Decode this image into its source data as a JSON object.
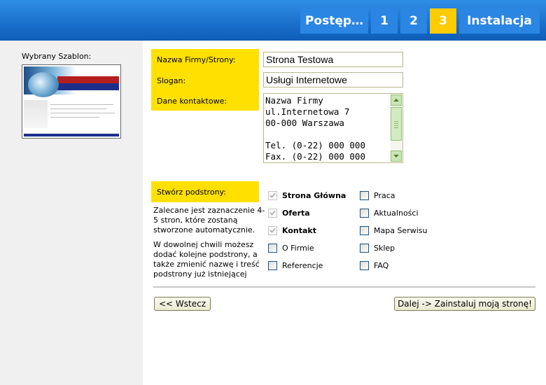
{
  "progress": {
    "label": "Postęp…",
    "steps": [
      "1",
      "2",
      "3"
    ],
    "active_step": "3",
    "final": "Instalacja"
  },
  "template": {
    "label": "Wybrany Szablon:",
    "thumbnail_icon": "template-thumbnail"
  },
  "form": {
    "company_label": "Nazwa Firmy/Strony:",
    "company_value": "Strona Testowa",
    "slogan_label": "Slogan:",
    "slogan_value": "Usługi Internetowe",
    "contact_label": "Dane kontaktowe:",
    "contact_value": "Nazwa Firmy\nul.Internetowa 7\n00-000 Warszawa\n\nTel. (0-22) 000 000\nFax. (0-22) 000 000"
  },
  "subpages": {
    "label": "Stwórz podstrony:",
    "desc1": "Zalecane jest zaznaczenie 4-5 stron, które zostaną stworzone automatycznie.",
    "desc2": "W dowolnej chwili możesz dodać kolejne podstrony, a także zmienić nazwę i treść podstrony już istniejącej",
    "left": [
      {
        "label": "Strona Główna",
        "checked": true,
        "disabled": true,
        "bold": true
      },
      {
        "label": "Oferta",
        "checked": true,
        "disabled": true,
        "bold": true
      },
      {
        "label": "Kontakt",
        "checked": true,
        "disabled": true,
        "bold": true
      },
      {
        "label": "O Firmie",
        "checked": false,
        "disabled": false,
        "bold": false
      },
      {
        "label": "Referencje",
        "checked": false,
        "disabled": false,
        "bold": false
      }
    ],
    "right": [
      {
        "label": "Praca",
        "checked": false
      },
      {
        "label": "Aktualności",
        "checked": false
      },
      {
        "label": "Mapa Serwisu",
        "checked": false
      },
      {
        "label": "Sklep",
        "checked": false
      },
      {
        "label": "FAQ",
        "checked": false
      }
    ]
  },
  "buttons": {
    "back": "<< Wstecz",
    "next": "Dalej -> Zainstaluj moją stronę!"
  },
  "colors": {
    "header": "#1a6fcb",
    "label_bg": "#ffe000",
    "active_step": "#ffcc00"
  }
}
